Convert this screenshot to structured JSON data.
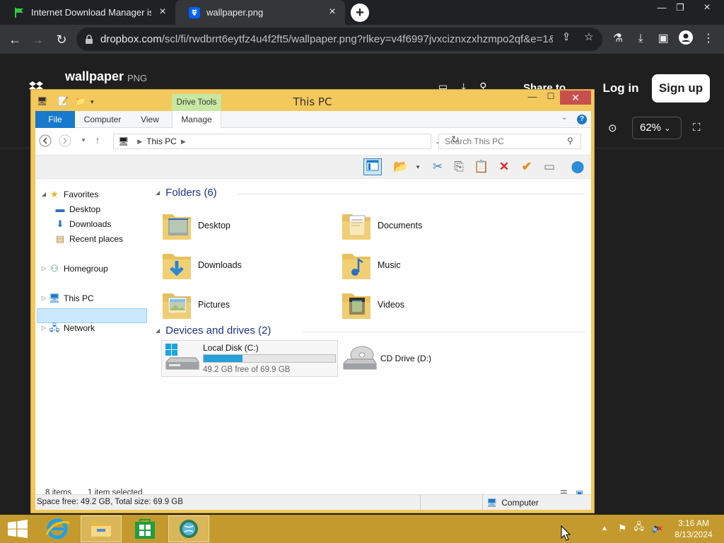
{
  "browser": {
    "tabs": [
      {
        "title": "Internet Download Manager is a"
      },
      {
        "title": "wallpaper.png"
      }
    ],
    "url_host": "dropbox.com",
    "url_rest": "/scl/fi/rwdbrrt6eytfz4u4f2ft5/wallpaper.png?rlkey=v4f6997jvxciznxzxhzmpo2qf&e=1&st..."
  },
  "dropbox": {
    "file_title": "wallpaper",
    "file_type": "PNG",
    "share_label": "Share to",
    "login": "Log in",
    "signup": "Sign up",
    "zoom": "62%"
  },
  "explorer": {
    "title": "This PC",
    "contextual_tab": "Drive Tools",
    "ribbon_tabs": [
      "File",
      "Computer",
      "View",
      "Manage"
    ],
    "address": "This PC",
    "search_placeholder": "Search This PC",
    "nav": {
      "favorites": "Favorites",
      "desktop": "Desktop",
      "downloads": "Downloads",
      "recent": "Recent places",
      "homegroup": "Homegroup",
      "thispc": "This PC",
      "network": "Network"
    },
    "folders_header": "Folders (6)",
    "folders": [
      "Desktop",
      "Documents",
      "Downloads",
      "Music",
      "Pictures",
      "Videos"
    ],
    "drives_header": "Devices and drives (2)",
    "drives": [
      {
        "name": "Local Disk (C:)",
        "detail": "49.2 GB free of 69.9 GB",
        "used_fraction": 0.296
      },
      {
        "name": "CD Drive (D:)"
      }
    ],
    "item_count": "8 items",
    "selection": "1 item selected",
    "statusbar_left": "Space free: 49.2 GB, Total size: 69.9 GB",
    "statusbar_right": "Computer"
  },
  "taskbar": {
    "time": "3:16 AM",
    "date": "8/13/2024"
  },
  "colors": {
    "window_frame": "#f3c85c",
    "taskbar": "#c49a2e",
    "accent_blue": "#1979ca",
    "close_red": "#c7504f"
  }
}
